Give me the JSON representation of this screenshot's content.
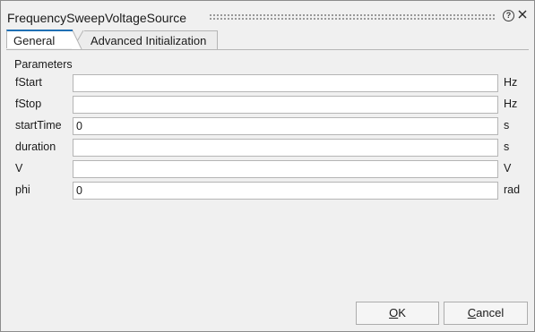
{
  "dialog": {
    "title": "FrequencySweepVoltageSource",
    "help_glyph": "?",
    "close_glyph": "×"
  },
  "tabs": [
    {
      "label": "General",
      "active": true
    },
    {
      "label": "Advanced Initialization",
      "active": false
    }
  ],
  "panel": {
    "section_title": "Parameters",
    "rows": [
      {
        "label": "fStart",
        "value": "",
        "unit": "Hz"
      },
      {
        "label": "fStop",
        "value": "",
        "unit": "Hz"
      },
      {
        "label": "startTime",
        "value": "0",
        "unit": "s"
      },
      {
        "label": "duration",
        "value": "",
        "unit": "s"
      },
      {
        "label": "V",
        "value": "",
        "unit": "V"
      },
      {
        "label": "phi",
        "value": "0",
        "unit": "rad"
      }
    ]
  },
  "buttons": {
    "ok": {
      "mnemonic": "O",
      "rest": "K"
    },
    "cancel": {
      "mnemonic": "C",
      "rest": "ancel"
    }
  },
  "colors": {
    "active_tab_accent": "#1f6fb4",
    "background": "#f0f0f0",
    "field_background": "#ffffff"
  }
}
